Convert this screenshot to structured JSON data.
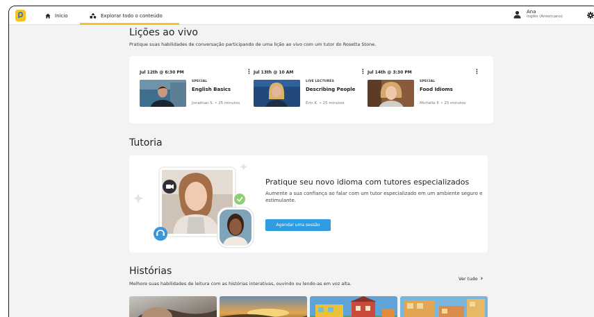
{
  "nav": {
    "home": "Inicio",
    "explore": "Explorar todo o conteúdo"
  },
  "user": {
    "name": "Ana",
    "language": "Inglês (Americano)"
  },
  "live": {
    "title": "Lições ao vivo",
    "subtitle": "Pratique suas habilidades de conversação participando de uma lição ao vivo com um tutor do Rosetta Stone.",
    "lessons": [
      {
        "date": "Jul 12th @ 6:30 PM",
        "tag": "SPECIAL",
        "name": "English Basics",
        "meta": "Jonathan S. • 25 minutos"
      },
      {
        "date": "Jul 13th @ 10 AM",
        "tag": "LIVE LECTURES",
        "name": "Describing People",
        "meta": "Erin K. • 25 minutos"
      },
      {
        "date": "Jul 14th @ 3:30 PM",
        "tag": "SPECIAL",
        "name": "Food Idioms",
        "meta": "Michelle P. • 25 minutos"
      }
    ],
    "menu_glyph": "⋮"
  },
  "tutoring": {
    "title": "Tutoria",
    "heading": "Pratique seu novo idioma com tutores especializados",
    "description": "Aumente a sua confiança ao falar com um tutor especializado em um ambiente seguro e estimulante.",
    "button": "Agendar uma sessão"
  },
  "stories": {
    "title": "Histórias",
    "subtitle": "Melhore suas habilidades de leitura com as histórias interativas, ouvindo ou lendo-as em voz alta.",
    "see_all": "Ver tudo",
    "see_all_glyph": "›"
  },
  "colors": {
    "accent": "#f6c227",
    "button": "#2f9be0",
    "background": "#f3f3f4"
  }
}
